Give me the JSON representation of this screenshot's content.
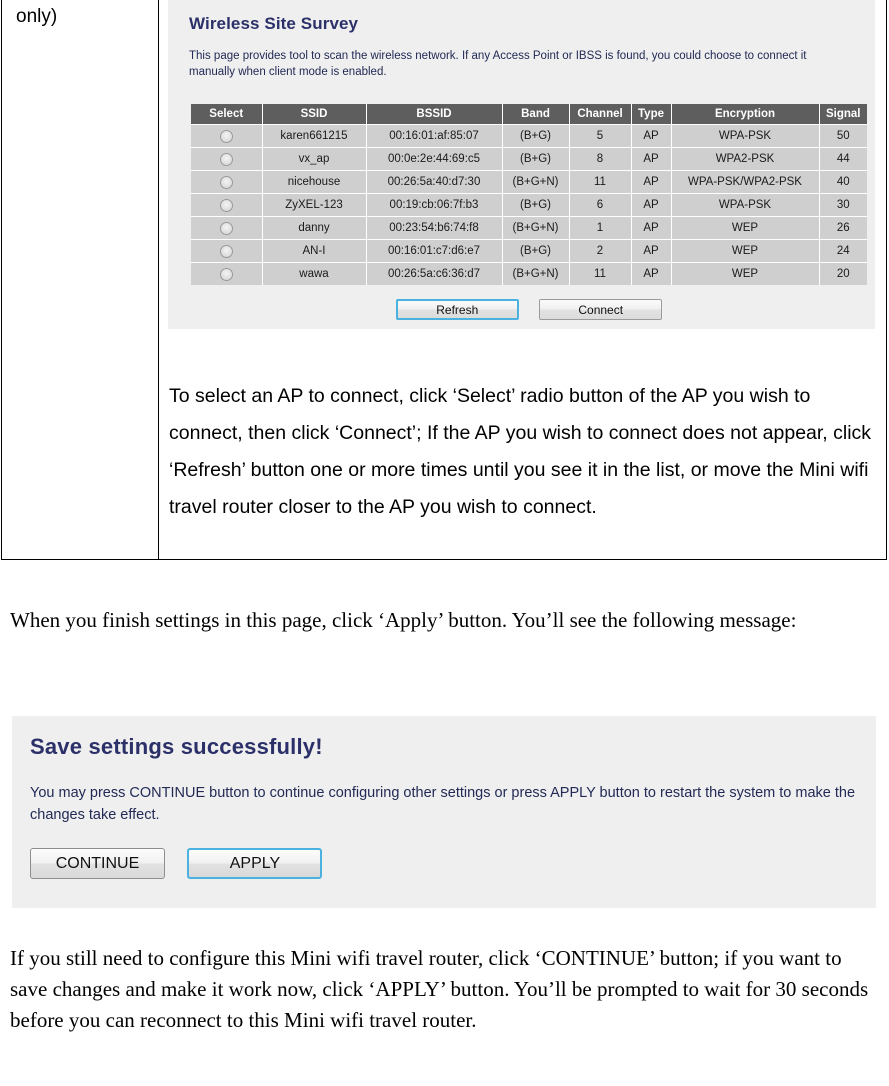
{
  "document": {
    "left_cell_text": "only)",
    "instruction_paragraph": "To select an AP to connect, click ‘Select’ radio button of the AP you wish to connect, then click ‘Connect’; If the AP you wish to connect does not appear, click ‘Refresh’ button one or more times until you see it in the list, or move the Mini wifi travel router closer to the AP you wish to connect.",
    "paragraph_apply": "When you finish settings in this page, click ‘Apply’ button. You’ll see the following message:",
    "paragraph_continue": "If you still need to configure this Mini wifi travel router, click ‘CONTINUE’ button; if you want to save changes and make it work now, click ‘APPLY’ button. You’ll be prompted to wait for 30 seconds before you can reconnect to this Mini wifi travel router."
  },
  "router_panel": {
    "title": "Wireless Site Survey",
    "description": "This page provides tool to scan the wireless network. If any Access Point or IBSS is found, you could choose to connect it manually when client mode is enabled.",
    "title_color": "#2b3069",
    "header_bg": "#5e5e5e",
    "row_bg": "#cfcfcf",
    "panel_bg": "#efefef",
    "table": {
      "columns": [
        "Select",
        "SSID",
        "BSSID",
        "Band",
        "Channel",
        "Type",
        "Encryption",
        "Signal"
      ],
      "rows": [
        {
          "select": "radio-unselected-icon",
          "ssid": "karen661215",
          "bssid": "00:16:01:af:85:07",
          "band": "(B+G)",
          "channel": "5",
          "type": "AP",
          "encryption": "WPA-PSK",
          "signal": "50"
        },
        {
          "select": "radio-unselected-icon",
          "ssid": "vx_ap",
          "bssid": "00:0e:2e:44:69:c5",
          "band": "(B+G)",
          "channel": "8",
          "type": "AP",
          "encryption": "WPA2-PSK",
          "signal": "44"
        },
        {
          "select": "radio-unselected-icon",
          "ssid": "nicehouse",
          "bssid": "00:26:5a:40:d7:30",
          "band": "(B+G+N)",
          "channel": "11",
          "type": "AP",
          "encryption": "WPA-PSK/WPA2-PSK",
          "signal": "40"
        },
        {
          "select": "radio-unselected-icon",
          "ssid": "ZyXEL-123",
          "bssid": "00:19:cb:06:7f:b3",
          "band": "(B+G)",
          "channel": "6",
          "type": "AP",
          "encryption": "WPA-PSK",
          "signal": "30"
        },
        {
          "select": "radio-unselected-icon",
          "ssid": "danny",
          "bssid": "00:23:54:b6:74:f8",
          "band": "(B+G+N)",
          "channel": "1",
          "type": "AP",
          "encryption": "WEP",
          "signal": "26"
        },
        {
          "select": "radio-unselected-icon",
          "ssid": "AN-I",
          "bssid": "00:16:01:c7:d6:e7",
          "band": "(B+G)",
          "channel": "2",
          "type": "AP",
          "encryption": "WEP",
          "signal": "24"
        },
        {
          "select": "radio-unselected-icon",
          "ssid": "wawa",
          "bssid": "00:26:5a:c6:36:d7",
          "band": "(B+G+N)",
          "channel": "11",
          "type": "AP",
          "encryption": "WEP",
          "signal": "20"
        }
      ]
    },
    "buttons": {
      "refresh": "Refresh",
      "connect": "Connect",
      "focus_color": "#4ab2e0"
    }
  },
  "save_panel": {
    "title": "Save settings successfully!",
    "description": "You may press CONTINUE button to continue configuring other settings or press APPLY button to restart the system to make the changes take effect.",
    "buttons": {
      "continue": "CONTINUE",
      "apply": "APPLY",
      "focus_color": "#4ab2e0"
    },
    "panel_bg": "#efefef",
    "title_color": "#2b3069"
  }
}
